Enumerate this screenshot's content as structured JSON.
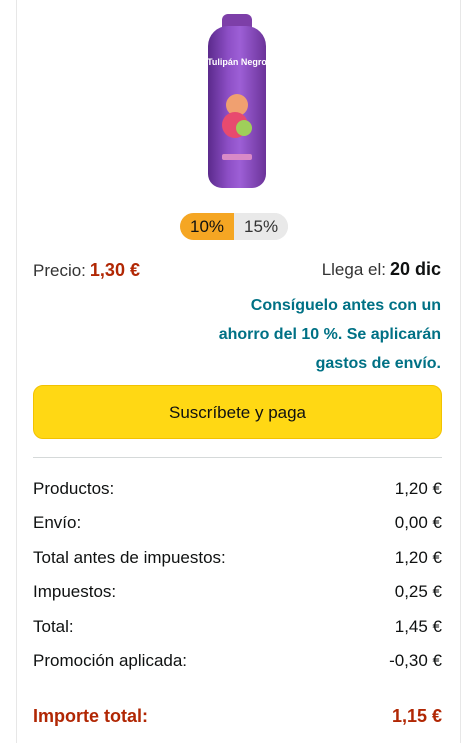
{
  "product": {
    "image_alt": "Tulipán Negro gel bottle",
    "brand_text": "Tulipán Negro"
  },
  "discount_options": {
    "selected": "10%",
    "other": "15%"
  },
  "pricing": {
    "price_label": "Precio:",
    "price_value": "1,30 €",
    "arrival_label": "Llega el:",
    "arrival_date": "20 dic"
  },
  "promo_message": "Consíguelo antes con un ahorro del 10 %. Se aplicarán gastos de envío.",
  "actions": {
    "subscribe_label": "Suscríbete y paga"
  },
  "summary": {
    "rows": [
      {
        "label": "Productos:",
        "value": "1,20 €"
      },
      {
        "label": "Envío:",
        "value": "0,00 €"
      },
      {
        "label": "Total antes de impuestos:",
        "value": "1,20 €"
      },
      {
        "label": "Impuestos:",
        "value": "0,25 €"
      },
      {
        "label": "Total:",
        "value": "1,45 €"
      },
      {
        "label": "Promoción aplicada:",
        "value": "-0,30 €"
      }
    ],
    "total_label": "Importe total:",
    "total_value": "1,15 €"
  },
  "colors": {
    "accent_price": "#b12704",
    "link_teal": "#007185",
    "button_yellow": "#ffd814",
    "pill_orange": "#f5a623"
  }
}
